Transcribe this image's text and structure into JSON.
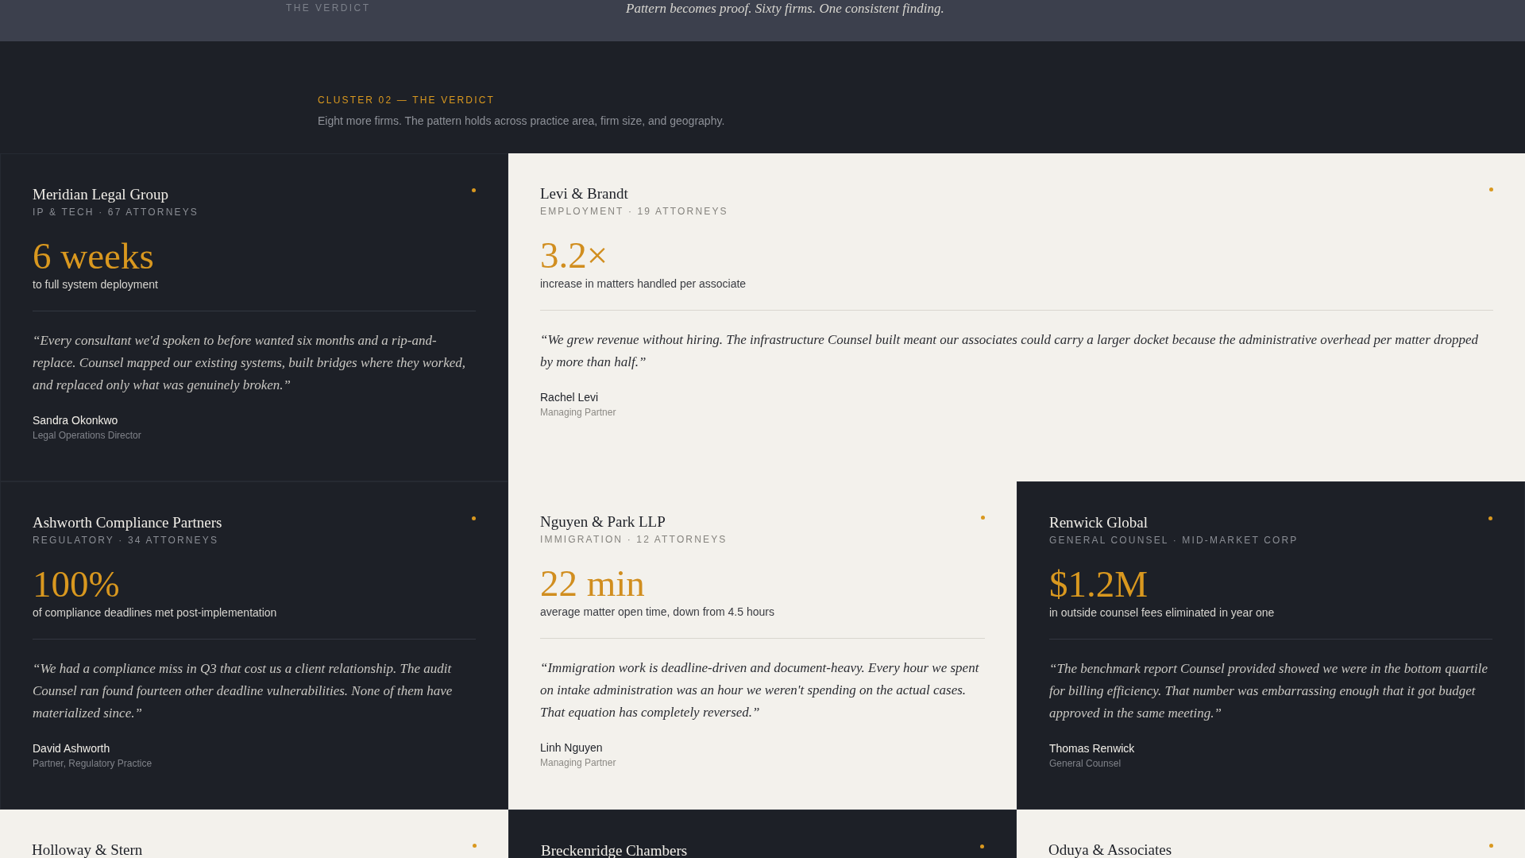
{
  "top_bar": {
    "label": "THE VERDICT",
    "tagline": "Pattern becomes proof. Sixty firms. One consistent finding."
  },
  "section": {
    "eyebrow": "CLUSTER 02 — THE VERDICT",
    "subtitle": "Eight more firms. The pattern holds across practice area, firm size, and geography."
  },
  "cards": [
    {
      "kind": "dark",
      "wide": false,
      "firm": "Meridian Legal Group",
      "meta": "IP & TECH · 67 ATTORNEYS",
      "stat": "6 weeks",
      "stat_label": "to full system deployment",
      "quote": "“Every consultant we'd spoken to before wanted six months and a rip-and-replace. Counsel mapped our existing systems, built bridges where they worked, and replaced only what was genuinely broken.”",
      "person": "Sandra Okonkwo",
      "role": "Legal Operations Director"
    },
    {
      "kind": "light",
      "wide": true,
      "firm": "Levi & Brandt",
      "meta": "EMPLOYMENT · 19 ATTORNEYS",
      "stat": "3.2×",
      "stat_label": "increase in matters handled per associate",
      "quote": "“We grew revenue without hiring. The infrastructure Counsel built meant our associates could carry a larger docket because the administrative overhead per matter dropped by more than half.”",
      "person": "Rachel Levi",
      "role": "Managing Partner"
    },
    {
      "kind": "dark",
      "wide": false,
      "firm": "Ashworth Compliance Partners",
      "meta": "REGULATORY · 34 ATTORNEYS",
      "stat": "100%",
      "stat_label": "of compliance deadlines met post-implementation",
      "quote": "“We had a compliance miss in Q3 that cost us a client relationship. The audit Counsel ran found fourteen other deadline vulnerabilities. None of them have materialized since.”",
      "person": "David Ashworth",
      "role": "Partner, Regulatory Practice"
    },
    {
      "kind": "light",
      "wide": false,
      "firm": "Nguyen & Park LLP",
      "meta": "IMMIGRATION · 12 ATTORNEYS",
      "stat": "22 min",
      "stat_label": "average matter open time, down from 4.5 hours",
      "quote": "“Immigration work is deadline-driven and document-heavy. Every hour we spent on intake administration was an hour we weren't spending on the actual cases. That equation has completely reversed.”",
      "person": "Linh Nguyen",
      "role": "Managing Partner"
    },
    {
      "kind": "dark",
      "wide": false,
      "firm": "Renwick Global",
      "meta": "GENERAL COUNSEL · MID-MARKET CORP",
      "stat": "$1.2M",
      "stat_label": "in outside counsel fees eliminated in year one",
      "quote": "“The benchmark report Counsel provided showed we were in the bottom quartile for billing efficiency. That number was embarrassing enough that it got budget approved in the same meeting.”",
      "person": "Thomas Renwick",
      "role": "General Counsel"
    },
    {
      "kind": "light",
      "wide": false,
      "firm": "Holloway & Stern"
    },
    {
      "kind": "dark",
      "wide": false,
      "firm": "Breckenridge Chambers"
    },
    {
      "kind": "light",
      "wide": false,
      "firm": "Oduya & Associates"
    }
  ]
}
